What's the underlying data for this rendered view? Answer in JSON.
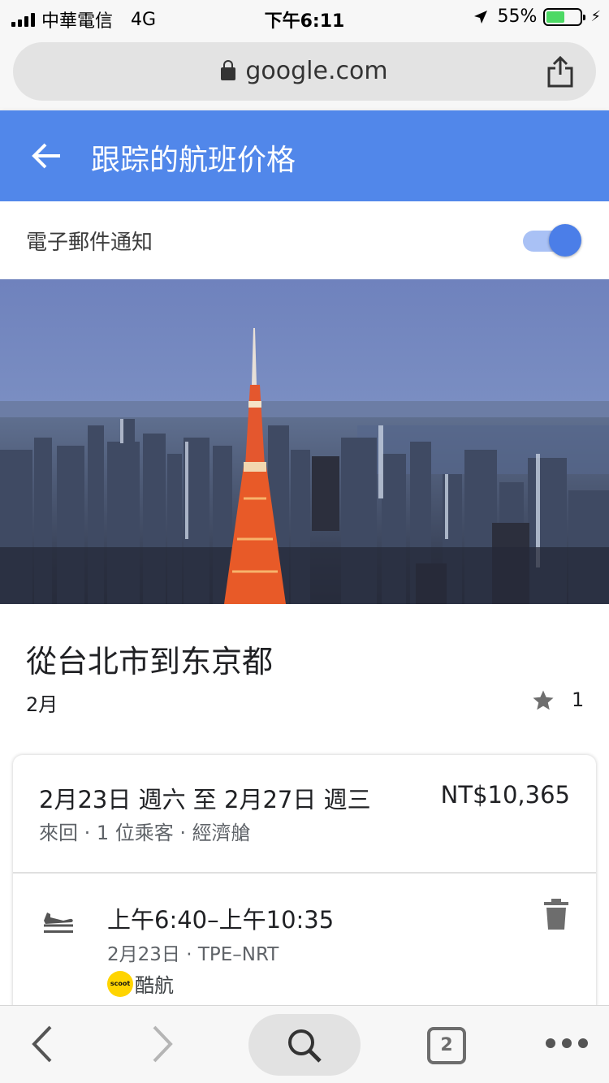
{
  "status_bar": {
    "carrier": "中華電信",
    "network": "4G",
    "time": "下午6:11",
    "battery_percent": "55%",
    "battery_level": 0.55
  },
  "browser": {
    "url": "google.com",
    "tab_count": "2"
  },
  "app_bar": {
    "title": "跟踪的航班价格"
  },
  "email_notification": {
    "label": "電子郵件通知",
    "enabled": true
  },
  "route": {
    "title": "從台北市到东京都",
    "month": "2月",
    "star_count": "1"
  },
  "card": {
    "dates": "2月23日 週六 至 2月27日 週三",
    "price": "NT$10,365",
    "meta": "來回 · 1 位乘客 · 經濟艙"
  },
  "flight": {
    "time": "上午6:40–上午10:35",
    "route": "2月23日 · TPE–NRT",
    "airline_logo_text": "scoot",
    "airline_name": "酷航"
  },
  "colors": {
    "app_bar": "#5187ea",
    "toggle_knob": "#4b7ee8",
    "toggle_track": "#a9c1f5",
    "battery": "#4cd964"
  }
}
